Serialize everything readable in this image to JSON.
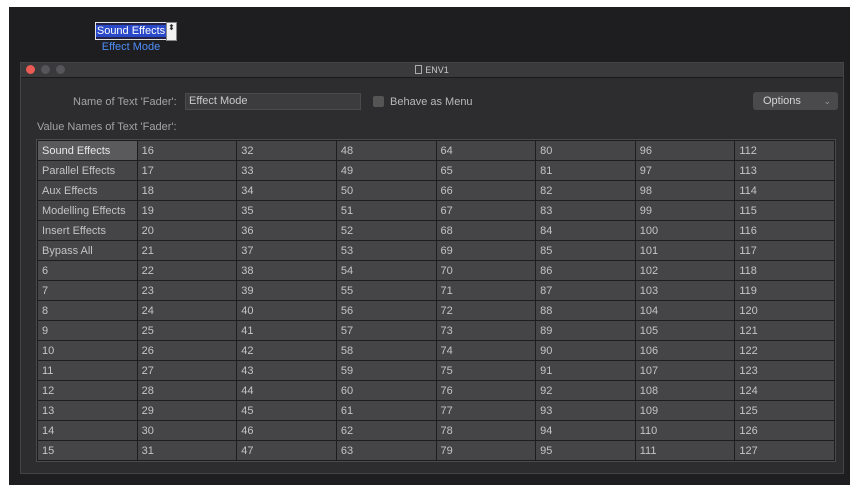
{
  "fader": {
    "selected_value": "Sound Effects",
    "caption": "Effect Mode",
    "arrow_glyph": "⬍"
  },
  "window": {
    "title": "ENV1",
    "name_label": "Name of Text 'Fader':",
    "name_value": "Effect Mode",
    "behave_label": "Behave as Menu",
    "options_label": "Options",
    "options_chevron": "⌄",
    "values_label": "Value Names of Text 'Fader':",
    "selected_index": 0,
    "value_names": [
      "Sound Effects",
      "Parallel Effects",
      "Aux Effects",
      "Modelling Effects",
      "Insert Effects",
      "Bypass All",
      "6",
      "7",
      "8",
      "9",
      "10",
      "11",
      "12",
      "13",
      "14",
      "15",
      "16",
      "17",
      "18",
      "19",
      "20",
      "21",
      "22",
      "23",
      "24",
      "25",
      "26",
      "27",
      "28",
      "29",
      "30",
      "31",
      "32",
      "33",
      "34",
      "35",
      "36",
      "37",
      "38",
      "39",
      "40",
      "41",
      "42",
      "43",
      "44",
      "45",
      "46",
      "47",
      "48",
      "49",
      "50",
      "51",
      "52",
      "53",
      "54",
      "55",
      "56",
      "57",
      "58",
      "59",
      "60",
      "61",
      "62",
      "63",
      "64",
      "65",
      "66",
      "67",
      "68",
      "69",
      "70",
      "71",
      "72",
      "73",
      "74",
      "75",
      "76",
      "77",
      "78",
      "79",
      "80",
      "81",
      "82",
      "83",
      "84",
      "85",
      "86",
      "87",
      "88",
      "89",
      "90",
      "91",
      "92",
      "93",
      "94",
      "95",
      "96",
      "97",
      "98",
      "99",
      "100",
      "101",
      "102",
      "103",
      "104",
      "105",
      "106",
      "107",
      "108",
      "109",
      "110",
      "111",
      "112",
      "113",
      "114",
      "115",
      "116",
      "117",
      "118",
      "119",
      "120",
      "121",
      "122",
      "123",
      "124",
      "125",
      "126",
      "127"
    ]
  }
}
